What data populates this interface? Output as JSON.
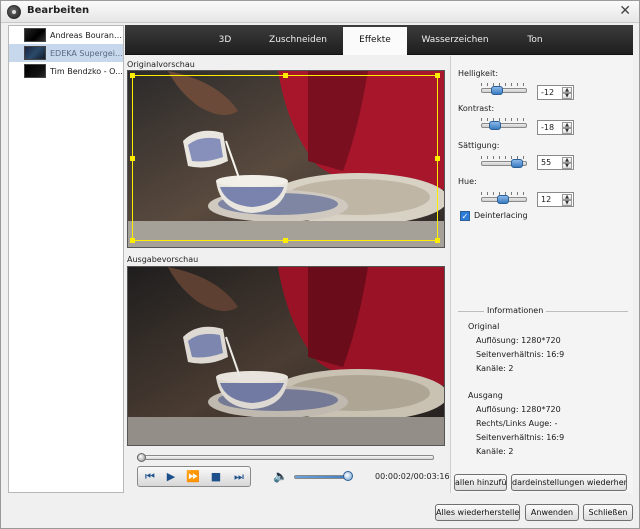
{
  "window": {
    "title": "Bearbeiten",
    "close_glyph": "✕"
  },
  "filelist": {
    "items": [
      {
        "label": "Andreas Bourani ...",
        "selected": false
      },
      {
        "label": "EDEKA Supergeil ...",
        "selected": true
      },
      {
        "label": "Tim Bendzko - O...",
        "selected": false
      }
    ]
  },
  "tabs": [
    {
      "label": "3D",
      "active": false
    },
    {
      "label": "Zuschneiden",
      "active": false
    },
    {
      "label": "Effekte",
      "active": true
    },
    {
      "label": "Wasserzeichen",
      "active": false
    },
    {
      "label": "Ton",
      "active": false
    }
  ],
  "previews": {
    "original_label": "Originalvorschau",
    "output_label": "Ausgabevorschau"
  },
  "effects": {
    "brightness": {
      "label": "Helligkeit:",
      "value": "-12"
    },
    "contrast": {
      "label": "Kontrast:",
      "value": "-18"
    },
    "saturation": {
      "label": "Sättigung:",
      "value": "55"
    },
    "hue": {
      "label": "Hue:",
      "value": "12"
    },
    "deinterlacing": {
      "label": "Deinterlacing",
      "checked": true
    }
  },
  "info": {
    "legend": "Informationen",
    "original": {
      "heading": "Original",
      "resolution": "Auflösung: 1280*720",
      "aspect": "Seitenverhältnis: 16:9",
      "channels": "Kanäle: 2"
    },
    "output": {
      "heading": "Ausgang",
      "resolution": "Auflösung: 1280*720",
      "right_left_eye": "Rechts/Links Auge: -",
      "aspect": "Seitenverhältnis: 16:9",
      "channels": "Kanäle: 2"
    }
  },
  "player": {
    "time": "00:00:02/00:03:16",
    "icons": [
      "skip-back-icon",
      "play-icon",
      "fast-forward-icon",
      "stop-icon",
      "skip-forward-icon",
      "volume-icon"
    ]
  },
  "buttons": {
    "apply_all": "allen hinzufüg",
    "restore_defaults": "dardeinstellungen wiederherst",
    "restore_all": "Alles wiederherstellen",
    "apply": "Anwenden",
    "close": "Schließen"
  },
  "colors": {
    "tab_bar": "#2b2b2b",
    "selection": "#c7d7ec",
    "crop_frame": "#ffee00",
    "accent_blue": "#2f7dd6"
  }
}
